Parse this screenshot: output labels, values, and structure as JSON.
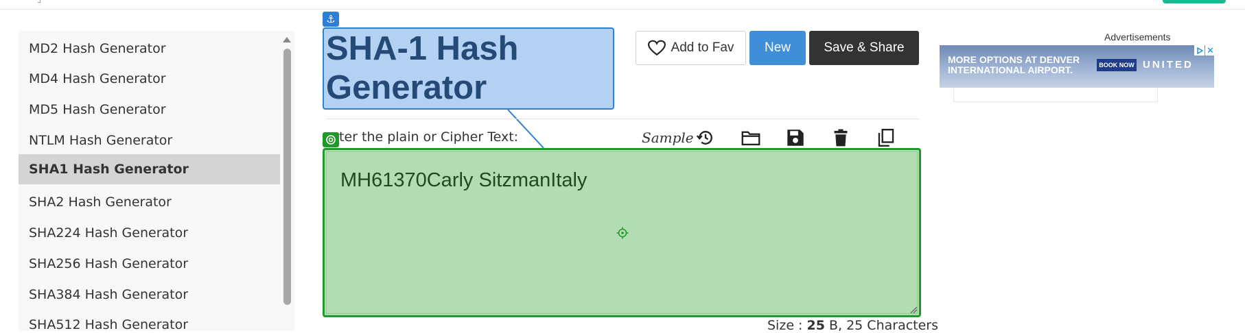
{
  "sidebar": {
    "items": [
      {
        "label": "MD2 Hash Generator"
      },
      {
        "label": "MD4 Hash Generator"
      },
      {
        "label": "MD5 Hash Generator"
      },
      {
        "label": "NTLM Hash Generator"
      },
      {
        "label": "SHA1 Hash Generator",
        "active": true
      },
      {
        "label": "SHA2 Hash Generator"
      },
      {
        "label": "SHA224 Hash Generator"
      },
      {
        "label": "SHA256 Hash Generator"
      },
      {
        "label": "SHA384 Hash Generator"
      },
      {
        "label": "SHA512 Hash Generator"
      }
    ]
  },
  "main": {
    "title": "SHA-1 Hash Generator",
    "buttons": {
      "fav_label": "Add to Fav",
      "new_label": "New",
      "save_label": "Save & Share"
    },
    "input_label": "ter the plain or Cipher Text:",
    "sample_label": "Sample",
    "tools": [
      "history-icon",
      "open-folder-icon",
      "save-icon",
      "delete-icon",
      "copy-icon"
    ],
    "textarea_value": "MH61370Carly SitzmanItaly",
    "size": {
      "prefix": "Size : ",
      "bytes": "25",
      "suffix": " B, 25 Characters"
    }
  },
  "ads": {
    "label": "Advertisements",
    "banner_line1": "MORE OPTIONS AT DENVER",
    "banner_line2": "INTERNATIONAL AIRPORT.",
    "book_now": "BOOK NOW",
    "brand": "UNITED"
  },
  "colors": {
    "accent_blue": "#3f8ed8",
    "dark_button": "#333333",
    "selection_blue": "#2d7fd6",
    "target_green": "#1f9a2a",
    "active_item": "#d4d4d4"
  }
}
